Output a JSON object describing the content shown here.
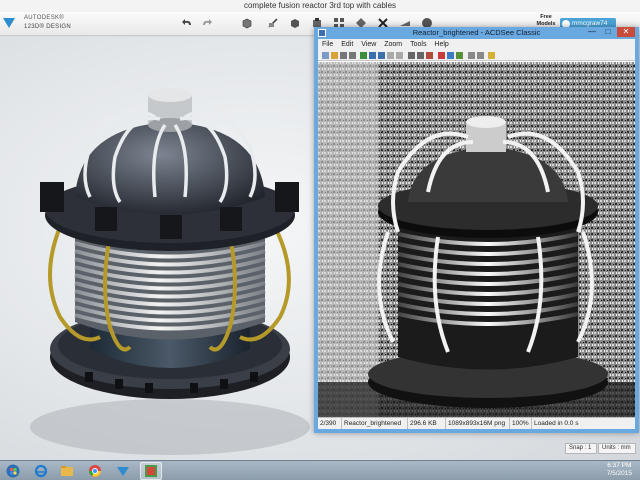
{
  "app": {
    "window_title": "complete fusion reactor 3rd top with cables",
    "brand_line1": "AUTODESK®",
    "brand_line2": "123D® DESIGN",
    "free_label": "Free\nModels",
    "username": "mmcgraw74",
    "icons": [
      "menu-icon",
      "undo-icon",
      "redo-icon",
      "primitives-icon",
      "sketch-icon",
      "construct-icon",
      "modify-icon",
      "pattern-icon",
      "grouping-icon",
      "combine-icon",
      "measure-icon",
      "delete-icon",
      "text-icon",
      "snap-icon",
      "material-icon"
    ],
    "status": {
      "snap": "Snap : 1",
      "units": "Units : mm"
    }
  },
  "acdsee": {
    "title": "Reactor_brightened - ACDSee Classic",
    "menu": [
      "File",
      "Edit",
      "View",
      "Zoom",
      "Tools",
      "Help"
    ],
    "close_glyph": "✕",
    "min_glyph": "—",
    "max_glyph": "□",
    "status": {
      "index": "2/390",
      "name": "Reactor_brightened",
      "size": "296.6 KB",
      "dims": "1089x893x16M png",
      "zoom": "100%",
      "load": "Loaded in 0.0 s"
    }
  },
  "taskbar": {
    "items": [
      "start-orb",
      "internet-explorer",
      "file-explorer",
      "chrome",
      "123d-design",
      "acdsee"
    ],
    "time": "6:37 PM",
    "date": "7/5/2015"
  }
}
